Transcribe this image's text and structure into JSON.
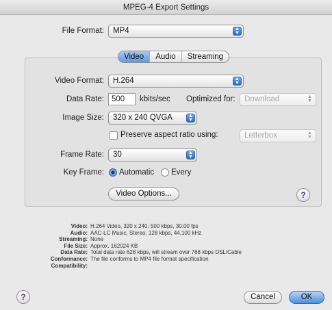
{
  "window": {
    "title": "MPEG-4 Export Settings"
  },
  "file_format": {
    "label": "File Format:",
    "value": "MP4"
  },
  "tabs": [
    {
      "label": "Video",
      "active": true
    },
    {
      "label": "Audio",
      "active": false
    },
    {
      "label": "Streaming",
      "active": false
    }
  ],
  "video_format": {
    "label": "Video Format:",
    "value": "H.264"
  },
  "data_rate": {
    "label": "Data Rate:",
    "value": "500",
    "unit": "kbits/sec",
    "optimized_label": "Optimized for:",
    "optimized_value": "Download"
  },
  "image_size": {
    "label": "Image Size:",
    "value": "320 x 240 QVGA"
  },
  "preserve": {
    "label": "Preserve aspect ratio using:",
    "value": "Letterbox"
  },
  "frame_rate": {
    "label": "Frame Rate:",
    "value": "30"
  },
  "key_frame": {
    "label": "Key Frame:",
    "automatic": "Automatic",
    "every": "Every"
  },
  "video_options_label": "Video Options...",
  "summary": [
    {
      "key": "Video:",
      "value": "H.264 Video, 320 x 240, 500 kbps, 30.00 fps"
    },
    {
      "key": "Audio:",
      "value": "AAC-LC Music, Stereo, 128 kbps, 44.100 kHz"
    },
    {
      "key": "Streaming:",
      "value": "None"
    },
    {
      "key": "File Size:",
      "value": "Approx. 162024 KB"
    },
    {
      "key": "Data Rate:",
      "value": "Total data rate 628 kbps, will stream over 768 kbps DSL/Cable"
    },
    {
      "key": "Conformance:",
      "value": "The file conforms to MP4 file format specification"
    },
    {
      "key": "Compatibility:",
      "value": ""
    }
  ],
  "buttons": {
    "cancel": "Cancel",
    "ok": "OK",
    "help": "?"
  }
}
